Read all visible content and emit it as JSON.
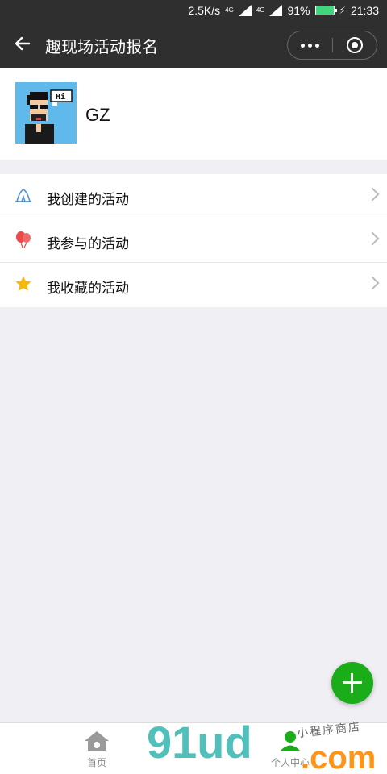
{
  "status_bar": {
    "speed": "2.5K/s",
    "net1": "4G",
    "net2": "4G",
    "battery": "91%",
    "time": "21:33"
  },
  "nav": {
    "title": "趣现场活动报名"
  },
  "profile": {
    "name": "GZ",
    "avatar_text": "Hi"
  },
  "menu": {
    "items": [
      {
        "label": "我创建的活动",
        "icon": "tent-icon",
        "color": "#4a90e2"
      },
      {
        "label": "我参与的活动",
        "icon": "balloon-icon",
        "color": "#e94b4b"
      },
      {
        "label": "我收藏的活动",
        "icon": "star-icon",
        "color": "#f5b90b"
      }
    ]
  },
  "tabbar": {
    "home": "首页",
    "profile": "个人中心"
  },
  "watermark": {
    "main": "91ud",
    "domain": ".com",
    "cn": "小程序商店"
  },
  "colors": {
    "nav_bg": "#2f2f2f",
    "accent": "#1aad19",
    "page_bg": "#efeff4"
  }
}
